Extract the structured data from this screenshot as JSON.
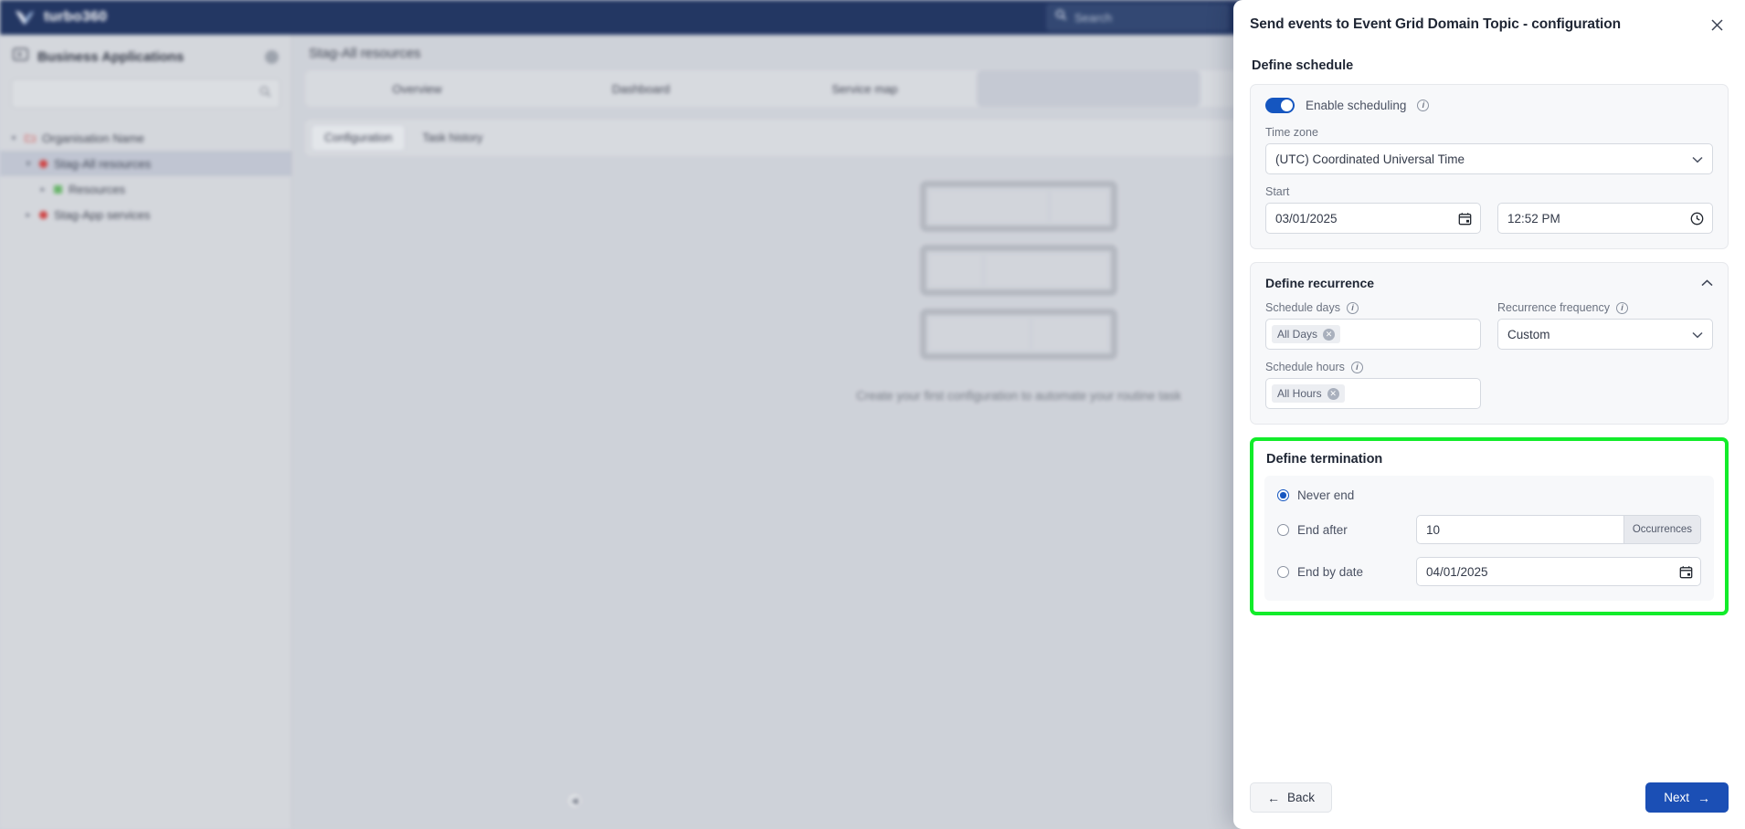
{
  "topbar": {
    "brand": "turbo360",
    "logo_icon": "turbo-bird-logo-icon",
    "search_placeholder": "Search",
    "search_icon": "search-icon",
    "bg_color": "#1b3268"
  },
  "sidebar": {
    "title": "Business Applications",
    "title_icon": "business-applications-icon",
    "gear_icon": "gear-icon",
    "search_icon": "search-icon",
    "search_value": "",
    "search_placeholder": "",
    "tree": [
      {
        "label": "Organisation Name",
        "icon": "folder-icon",
        "icon_color": "#e36a6a",
        "twisty": "chevron-down",
        "indent": 0,
        "selected": false
      },
      {
        "label": "Stag-All resources",
        "icon": "status-dot",
        "icon_color": "#e33b3b",
        "twisty": "chevron-down",
        "indent": 1,
        "selected": true
      },
      {
        "label": "Resources",
        "icon": "status-square",
        "icon_color": "#5cb85c",
        "twisty": "chevron-right",
        "indent": 2,
        "selected": false
      },
      {
        "label": "Stag-App services",
        "icon": "status-dot",
        "icon_color": "#e33b3b",
        "twisty": "chevron-right",
        "indent": 1,
        "selected": false
      }
    ],
    "collapse_icon": "chevron-left-icon"
  },
  "main": {
    "page_title": "Stag-All resources",
    "tabs": [
      {
        "label": "Overview",
        "active": false
      },
      {
        "label": "Dashboard",
        "active": false
      },
      {
        "label": "Service map",
        "active": false
      },
      {
        "label": "",
        "active": true
      }
    ],
    "subtabs": [
      {
        "label": "Configuration",
        "active": true
      },
      {
        "label": "Task history",
        "active": false
      }
    ],
    "empty_state_text": "Create your first configuration to automate your routine task"
  },
  "panel": {
    "title": "Send events to Event Grid Domain Topic - configuration",
    "close_icon": "close-icon",
    "schedule": {
      "heading": "Define schedule",
      "enable_label": "Enable scheduling",
      "enable_info_icon": "info-icon",
      "enable_value": true,
      "timezone_label": "Time zone",
      "timezone_value": "(UTC) Coordinated Universal Time",
      "timezone_chevron_icon": "chevron-down-icon",
      "start_label": "Start",
      "start_date_value": "03/01/2025",
      "start_date_icon": "calendar-icon",
      "start_time_value": "12:52 PM",
      "start_time_icon": "clock-icon"
    },
    "recurrence": {
      "heading": "Define recurrence",
      "collapse_icon": "chevron-up-icon",
      "schedule_days_label": "Schedule days",
      "schedule_days_info_icon": "info-icon",
      "schedule_days_tag": "All Days",
      "schedule_days_tag_remove_icon": "remove-tag-icon",
      "frequency_label": "Recurrence frequency",
      "frequency_info_icon": "info-icon",
      "frequency_value": "Custom",
      "frequency_chevron_icon": "chevron-down-icon",
      "schedule_hours_label": "Schedule hours",
      "schedule_hours_info_icon": "info-icon",
      "schedule_hours_tag": "All Hours",
      "schedule_hours_tag_remove_icon": "remove-tag-icon"
    },
    "termination": {
      "heading": "Define termination",
      "highlight_color": "#12ec2a",
      "options": [
        {
          "label": "Never end",
          "selected": true
        },
        {
          "label": "End after",
          "selected": false
        },
        {
          "label": "End by date",
          "selected": false
        }
      ],
      "occurrences_value": "10",
      "occurrences_suffix": "Occurrences",
      "end_by_date_value": "04/01/2025",
      "end_by_date_icon": "calendar-icon"
    },
    "footer": {
      "back_label": "Back",
      "back_icon": "arrow-left-icon",
      "next_label": "Next",
      "next_icon": "arrow-right-icon",
      "next_color": "#1b4fb5"
    }
  }
}
